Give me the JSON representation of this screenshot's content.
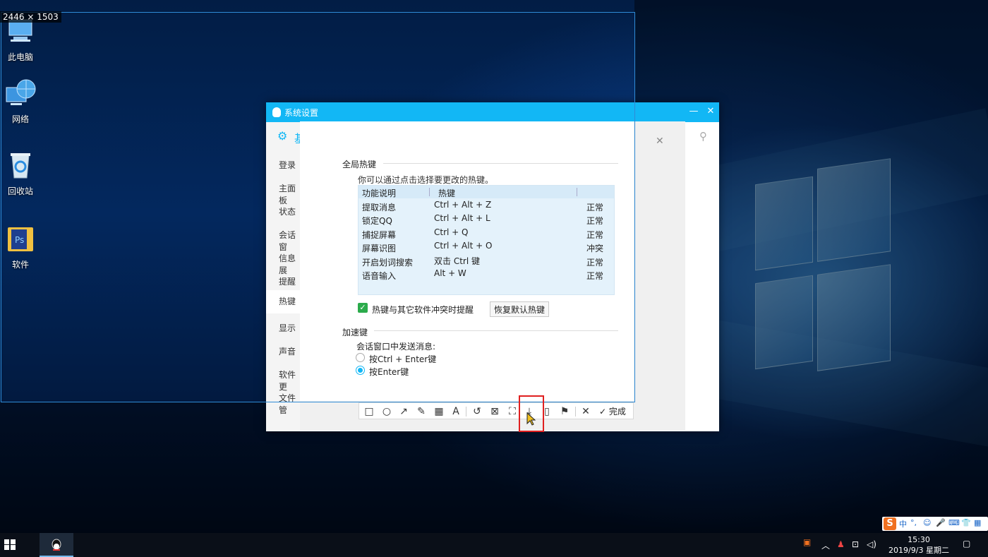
{
  "desktop": {
    "size_label": "2446 × 1503",
    "icons": [
      {
        "label": "此电脑",
        "icon": "computer-icon"
      },
      {
        "label": "网络",
        "icon": "network-icon"
      },
      {
        "label": "回收站",
        "icon": "recycle-bin-icon"
      },
      {
        "label": "软件",
        "icon": "photoshop-folder-icon"
      }
    ]
  },
  "window": {
    "title": "系统设置",
    "sidebar": {
      "header": "基",
      "items": [
        "登录",
        "主面板",
        "状态",
        "会话窗",
        "信息展",
        "提醒",
        "热键",
        "显示",
        "声音",
        "软件更",
        "文件管"
      ],
      "active": "热键"
    }
  },
  "hotkeys": {
    "section_title": "全局热键",
    "hint": "你可以通过点击选择要更改的热键。",
    "columns": [
      "功能说明",
      "热键",
      ""
    ],
    "rows": [
      {
        "name": "提取消息",
        "key": "Ctrl + Alt + Z",
        "status": "正常"
      },
      {
        "name": "锁定QQ",
        "key": "Ctrl + Alt + L",
        "status": "正常"
      },
      {
        "name": "捕捉屏幕",
        "key": "Ctrl + Q",
        "status": "正常"
      },
      {
        "name": "屏幕识图",
        "key": "Ctrl + Alt + O",
        "status": "冲突"
      },
      {
        "name": "开启划词搜索",
        "key": "双击 Ctrl 键",
        "status": "正常"
      },
      {
        "name": "语音输入",
        "key": "Alt + W",
        "status": "正常"
      }
    ],
    "conflict_checkbox_label": "热键与其它软件冲突时提醒",
    "conflict_checkbox_checked": true,
    "restore_button": "恢复默认热键"
  },
  "accelerator": {
    "section_title": "加速键",
    "send_label": "会话窗口中发送消息:",
    "options": [
      "按Ctrl + Enter键",
      "按Enter键"
    ],
    "selected": "按Enter键"
  },
  "screenshot_toolbar": {
    "tools": [
      "rectangle-icon",
      "ellipse-icon",
      "arrow-icon",
      "pen-icon",
      "mosaic-icon",
      "text-icon",
      "undo-icon",
      "ocr-icon",
      "scroll-capture-icon",
      "download-icon",
      "screen-record-icon",
      "pin-icon",
      "cancel-icon"
    ],
    "done_label": "完成"
  },
  "taskbar": {
    "time": "15:30",
    "date": "2019/9/3 星期二",
    "ime_mode": "中"
  },
  "colors": {
    "accent": "#12b7f5",
    "highlight_box": "#e02020",
    "checkbox_green": "#2bab4b",
    "table_bg": "#e4f2fb"
  }
}
